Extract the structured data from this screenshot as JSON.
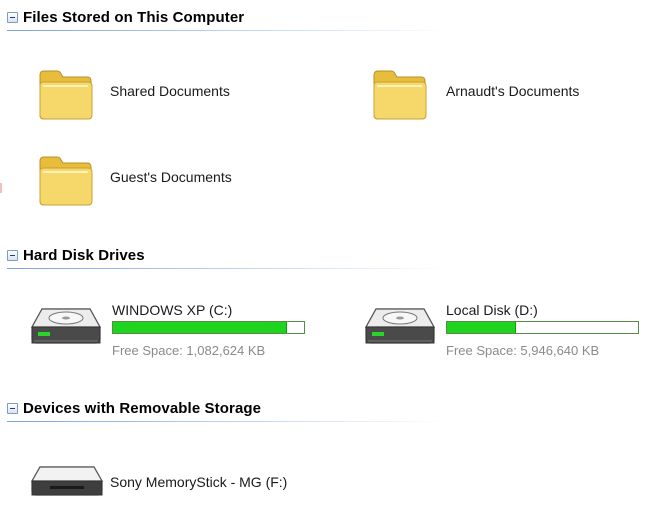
{
  "groups": {
    "files": {
      "title": "Files Stored on This Computer",
      "items": [
        {
          "label": "Shared Documents",
          "icon": "folder-icon"
        },
        {
          "label": "Arnaudt's Documents",
          "icon": "folder-icon"
        },
        {
          "label": "Guest's Documents",
          "icon": "folder-icon"
        }
      ]
    },
    "hard_disks": {
      "title": "Hard Disk Drives",
      "items": [
        {
          "label": "WINDOWS XP (C:)",
          "free_space": "Free Space: 1,082,624 KB",
          "used_fraction": 0.91,
          "icon": "hard-drive-icon"
        },
        {
          "label": "Local Disk (D:)",
          "free_space": "Free Space: 5,946,640 KB",
          "used_fraction": 0.36,
          "icon": "hard-drive-icon"
        }
      ]
    },
    "removable": {
      "title": "Devices with Removable Storage",
      "items": [
        {
          "label": "Sony MemoryStick - MG (F:)",
          "icon": "removable-drive-icon"
        }
      ]
    }
  },
  "colors": {
    "usage_fill": "#1fd41f",
    "folder_yellow": "#f6d76a",
    "header_rule": "#7aa1e6"
  }
}
